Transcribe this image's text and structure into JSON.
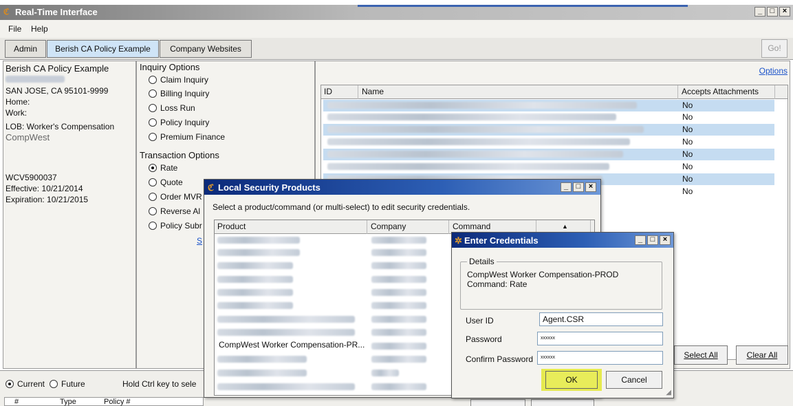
{
  "window": {
    "title": "Real-Time Interface"
  },
  "menu": {
    "file": "File",
    "help": "Help"
  },
  "tabs": [
    "Admin",
    "Berish CA Policy Example",
    "Company Websites"
  ],
  "go_label": "Go!",
  "client": {
    "name": "Berish CA Policy Example",
    "address": "SAN JOSE, CA 95101-9999",
    "home": "Home:",
    "work": "Work:",
    "lob": "LOB: Worker's Compensation",
    "carrier": "CompWest",
    "policy_no": "WCV5900037",
    "effective": "Effective: 10/21/2014",
    "expiration": "Expiration: 10/21/2015"
  },
  "inquiry": {
    "title": "Inquiry Options",
    "options": [
      "Claim Inquiry",
      "Billing Inquiry",
      "Loss Run",
      "Policy Inquiry",
      "Premium Finance"
    ]
  },
  "transaction": {
    "title": "Transaction Options",
    "options": [
      "Rate",
      "Quote",
      "Order MVR",
      "Reverse Al",
      "Policy Subr"
    ],
    "selected": "Rate",
    "link_fragment": "S"
  },
  "options_link": "Options",
  "attachments_table": {
    "headers": [
      "ID",
      "Name",
      "Accepts Attachments"
    ],
    "rows": [
      "No",
      "No",
      "No",
      "No",
      "No",
      "No",
      "No",
      "No"
    ]
  },
  "select_all": "Select All",
  "clear_all": "Clear All",
  "bottom": {
    "current": "Current",
    "future": "Future",
    "hint": "Hold Ctrl key to sele",
    "col_hash": "#",
    "col_type": "Type",
    "col_policy": "Policy #"
  },
  "security_dialog": {
    "title": "Local Security Products",
    "instruction": "Select a product/command (or multi-select) to edit security credentials.",
    "headers": [
      "Product",
      "Company",
      "Command"
    ],
    "visible_product": "CompWest Worker Compensation-PR..."
  },
  "credentials_dialog": {
    "title": "Enter Credentials",
    "details_label": "Details",
    "details_line1": "CompWest Worker Compensation-PROD",
    "details_line2": "Command: Rate",
    "user_id_label": "User ID",
    "user_id_value": "Agent.CSR",
    "password_label": "Password",
    "password_value": "xxxxxx",
    "confirm_label": "Confirm Password",
    "confirm_value": "xxxxxx",
    "ok": "OK",
    "cancel": "Cancel"
  },
  "colors": {
    "highlight_ok": "#e6ea4f",
    "row_alt": "#c5dcf1",
    "title_blue": "#0b2a7a"
  }
}
